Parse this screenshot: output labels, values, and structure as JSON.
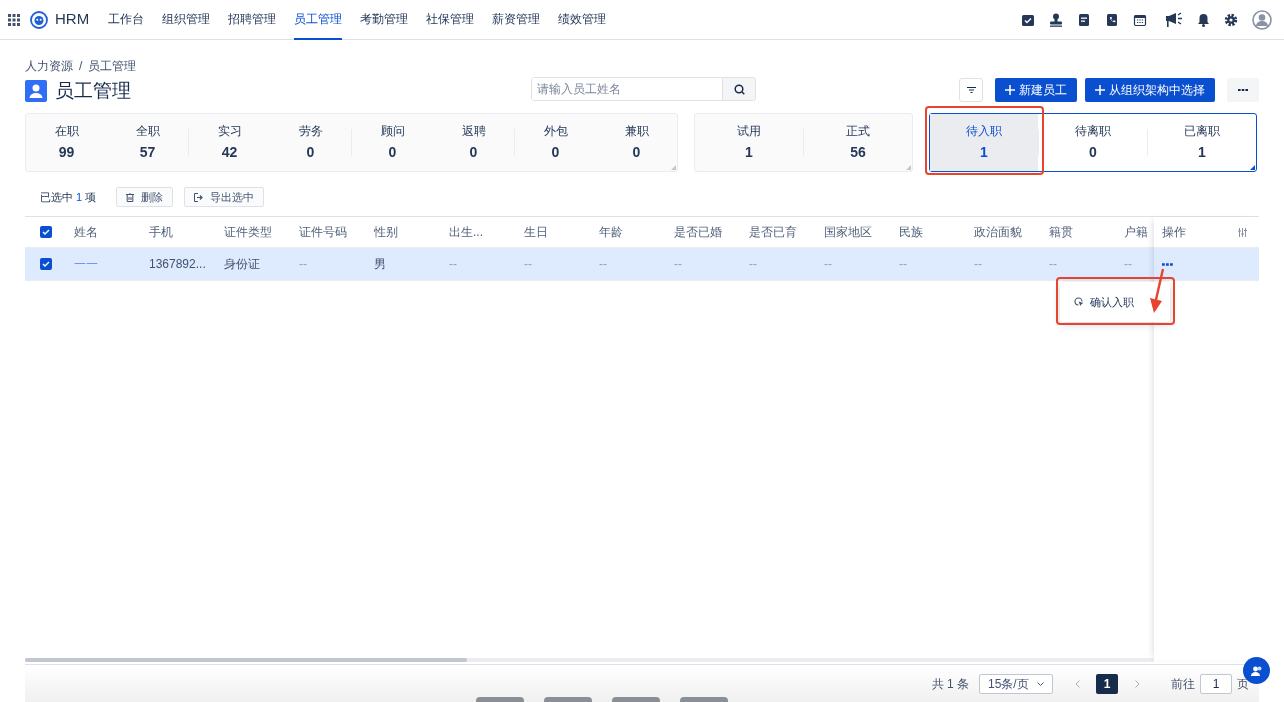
{
  "nav": {
    "brand": "HRM",
    "menu_items": [
      {
        "label": "工作台",
        "selected": false
      },
      {
        "label": "组织管理",
        "selected": false
      },
      {
        "label": "招聘管理",
        "selected": false
      },
      {
        "label": "员工管理",
        "selected": true
      },
      {
        "label": "考勤管理",
        "selected": false
      },
      {
        "label": "社保管理",
        "selected": false
      },
      {
        "label": "薪资管理",
        "selected": false
      },
      {
        "label": "绩效管理",
        "selected": false
      }
    ]
  },
  "breadcrumb": [
    "人力资源",
    "员工管理"
  ],
  "breadcrumb_separator": "/",
  "page_title": "员工管理",
  "search": {
    "placeholder": "请输入员工姓名"
  },
  "buttons": {
    "new_employee": "新建员工",
    "from_org": "从组织架构中选择"
  },
  "stat_groups": [
    {
      "items": [
        {
          "label": "在职",
          "value": "99",
          "selected": false
        },
        {
          "label": "全职",
          "value": "57",
          "selected": false
        },
        {
          "label": "实习",
          "value": "42",
          "selected": false
        },
        {
          "label": "劳务",
          "value": "0",
          "selected": false
        },
        {
          "label": "顾问",
          "value": "0",
          "selected": false
        },
        {
          "label": "返聘",
          "value": "0",
          "selected": false
        },
        {
          "label": "外包",
          "value": "0",
          "selected": false
        },
        {
          "label": "兼职",
          "value": "0",
          "selected": false
        }
      ]
    },
    {
      "items": [
        {
          "label": "试用",
          "value": "1",
          "selected": false
        },
        {
          "label": "正式",
          "value": "56",
          "selected": false
        }
      ]
    },
    {
      "items": [
        {
          "label": "待入职",
          "value": "1",
          "selected": true
        },
        {
          "label": "待离职",
          "value": "0",
          "selected": false
        },
        {
          "label": "已离职",
          "value": "1",
          "selected": false
        }
      ]
    }
  ],
  "selection_bar": {
    "prefix": "已选中",
    "count": "1",
    "suffix": "项",
    "delete": "删除",
    "export": "导出选中"
  },
  "table": {
    "header_checked": true,
    "columns": [
      "姓名",
      "手机",
      "证件类型",
      "证件号码",
      "性别",
      "出生...",
      "生日",
      "年龄",
      "是否已婚",
      "是否已育",
      "国家地区",
      "民族",
      "政治面貌",
      "籍贯",
      "户籍"
    ],
    "action_column": "操作",
    "rows": [
      {
        "checked": true,
        "cells": [
          "一一",
          "1367892...",
          "身份证",
          "--",
          "男",
          "--",
          "--",
          "--",
          "--",
          "--",
          "--",
          "--",
          "--",
          "--",
          "--"
        ]
      }
    ]
  },
  "dropdown": {
    "items": [
      "确认入职"
    ]
  },
  "pagination": {
    "total": "共 1 条",
    "page_size": "15条/页",
    "pages": [
      {
        "label": "1",
        "selected": true
      }
    ],
    "goto_label": "前往",
    "goto_value": "1",
    "page_unit": "页"
  }
}
